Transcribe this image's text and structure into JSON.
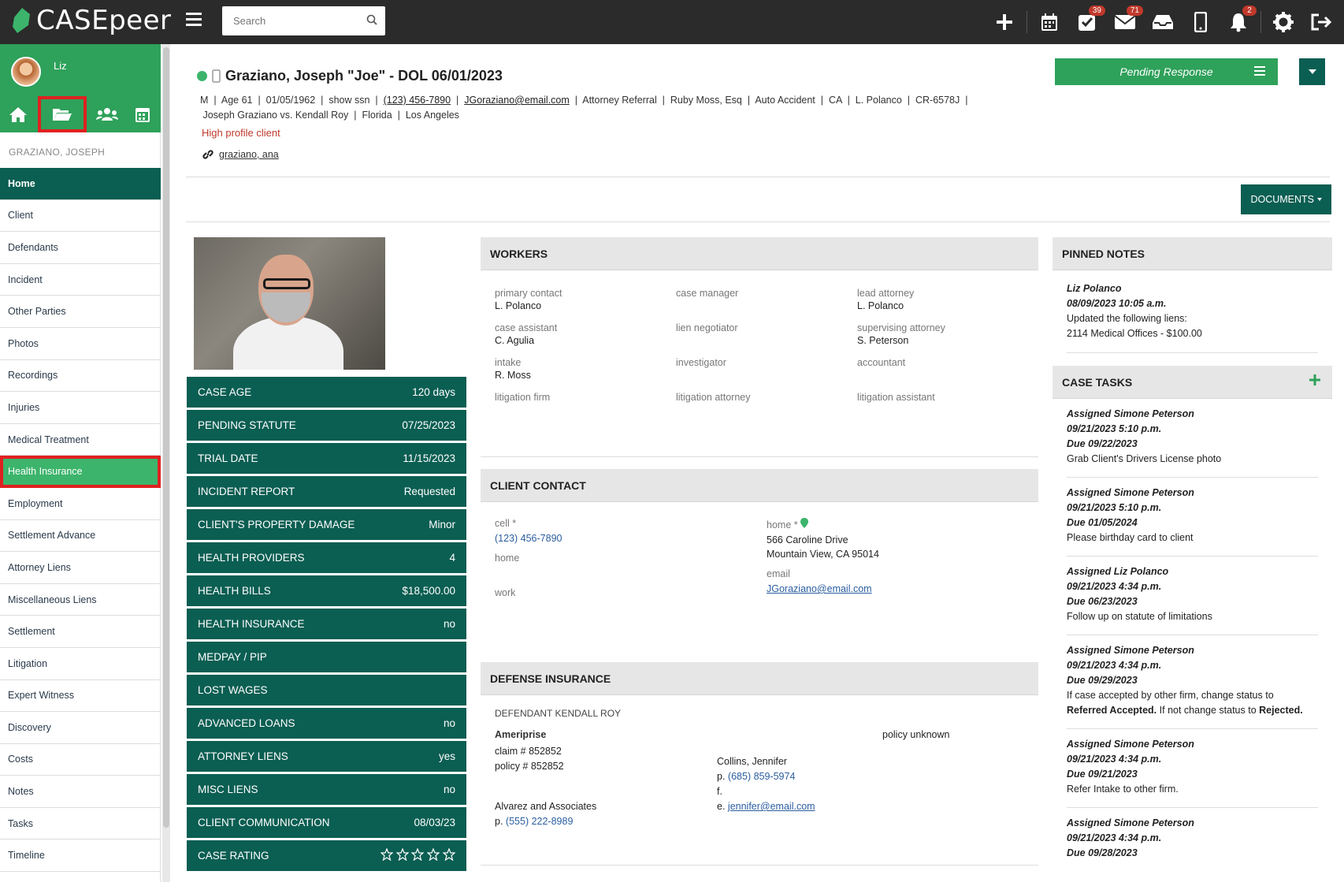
{
  "app": {
    "name": "CASEpeer"
  },
  "search": {
    "placeholder": "Search"
  },
  "topbar": {
    "badges": {
      "tasks": "39",
      "mail": "71",
      "notifications": "2"
    }
  },
  "sidebar": {
    "user_name": "Liz",
    "client_label": "GRAZIANO, JOSEPH",
    "items": [
      {
        "label": "Home"
      },
      {
        "label": "Client"
      },
      {
        "label": "Defendants"
      },
      {
        "label": "Incident"
      },
      {
        "label": "Other Parties"
      },
      {
        "label": "Photos"
      },
      {
        "label": "Recordings"
      },
      {
        "label": "Injuries"
      },
      {
        "label": "Medical Treatment"
      },
      {
        "label": "Health Insurance"
      },
      {
        "label": "Employment"
      },
      {
        "label": "Settlement Advance"
      },
      {
        "label": "Attorney Liens"
      },
      {
        "label": "Miscellaneous Liens"
      },
      {
        "label": "Settlement"
      },
      {
        "label": "Litigation"
      },
      {
        "label": "Expert Witness"
      },
      {
        "label": "Discovery"
      },
      {
        "label": "Costs"
      },
      {
        "label": "Notes"
      },
      {
        "label": "Tasks"
      },
      {
        "label": "Timeline"
      }
    ]
  },
  "case": {
    "title": "Graziano, Joseph \"Joe\" - DOL 06/01/2023",
    "meta_line1": [
      "M",
      "Age 61",
      "01/05/1962",
      "show ssn",
      "(123) 456-7890",
      "JGoraziano@email.com",
      "Attorney Referral",
      "Ruby Moss, Esq",
      "Auto Accident",
      "CA",
      "L. Polanco",
      "CR-6578J"
    ],
    "meta_line2": [
      "Joseph Graziano vs. Kendall Roy",
      "Florida",
      "Los Angeles"
    ],
    "high_profile": "High profile client",
    "related": "graziano, ana",
    "status": "Pending Response",
    "documents": "DOCUMENTS"
  },
  "stats": [
    {
      "label": "CASE AGE",
      "value": "120 days"
    },
    {
      "label": "PENDING STATUTE",
      "value": "07/25/2023"
    },
    {
      "label": "TRIAL DATE",
      "value": "11/15/2023"
    },
    {
      "label": "INCIDENT REPORT",
      "value": "Requested"
    },
    {
      "label": "CLIENT'S PROPERTY DAMAGE",
      "value": "Minor"
    },
    {
      "label": "HEALTH PROVIDERS",
      "value": "4"
    },
    {
      "label": "HEALTH BILLS",
      "value": "$18,500.00"
    },
    {
      "label": "HEALTH INSURANCE",
      "value": "no"
    },
    {
      "label": "MEDPAY / PIP",
      "value": ""
    },
    {
      "label": "LOST WAGES",
      "value": ""
    },
    {
      "label": "ADVANCED LOANS",
      "value": "no"
    },
    {
      "label": "ATTORNEY LIENS",
      "value": "yes"
    },
    {
      "label": "MISC LIENS",
      "value": "no"
    },
    {
      "label": "CLIENT COMMUNICATION",
      "value": "08/03/23"
    },
    {
      "label": "CASE RATING",
      "value": ""
    }
  ],
  "case_rating": 0,
  "workers": {
    "title": "WORKERS",
    "cells": [
      {
        "label": "primary contact",
        "value": "L. Polanco"
      },
      {
        "label": "case manager",
        "value": ""
      },
      {
        "label": "lead attorney",
        "value": "L. Polanco"
      },
      {
        "label": "case assistant",
        "value": "C. Agulia"
      },
      {
        "label": "lien negotiator",
        "value": ""
      },
      {
        "label": "supervising attorney",
        "value": "S. Peterson"
      },
      {
        "label": "intake",
        "value": "R. Moss"
      },
      {
        "label": "investigator",
        "value": ""
      },
      {
        "label": "accountant",
        "value": ""
      },
      {
        "label": "litigation firm",
        "value": ""
      },
      {
        "label": "litigation attorney",
        "value": ""
      },
      {
        "label": "litigation assistant",
        "value": ""
      }
    ]
  },
  "contact": {
    "title": "CLIENT CONTACT",
    "cell_label": "cell *",
    "cell_value": "(123) 456-7890",
    "home_label": "home",
    "work_label": "work",
    "home2_label": "home *",
    "address1": "566 Caroline Drive",
    "address2": "Mountain View, CA 95014",
    "email_label": "email",
    "email": "JGoraziano@email.com"
  },
  "defense": {
    "title": "DEFENSE INSURANCE",
    "defendant": "DEFENDANT KENDALL ROY",
    "carrier": "Ameriprise",
    "claim": "claim # 852852",
    "policy": "policy # 852852",
    "policy_status": "policy unknown",
    "adjuster": "Collins, Jennifer",
    "adj_phone_prefix": "p.",
    "adj_phone": "(685) 859-5974",
    "adj_fax": "f.",
    "adj_email_prefix": "e.",
    "adj_email": "jennifer@email.com",
    "firm": "Alvarez and Associates",
    "firm_phone_prefix": "p.",
    "firm_phone": "(555) 222-8989"
  },
  "pinned": {
    "title": "PINNED NOTES",
    "author": "Liz Polanco",
    "date": "08/09/2023 10:05 a.m.",
    "line1": "Updated the following liens:",
    "line2": "2114 Medical Offices - $100.00"
  },
  "tasks": {
    "title": "CASE TASKS",
    "items": [
      {
        "assigned": "Assigned Simone Peterson",
        "date": "09/21/2023 5:10 p.m.",
        "due": "Due 09/22/2023",
        "text": "Grab Client's Drivers License photo"
      },
      {
        "assigned": "Assigned Simone Peterson",
        "date": "09/21/2023 5:10 p.m.",
        "due": "Due 01/05/2024",
        "text": "Please birthday card to client"
      },
      {
        "assigned": "Assigned Liz Polanco",
        "date": "09/21/2023 4:34 p.m.",
        "due": "Due 06/23/2023",
        "text": "Follow up on statute of limitations"
      },
      {
        "assigned": "Assigned Simone Peterson",
        "date": "09/21/2023 4:34 p.m.",
        "due": "Due 09/29/2023",
        "text_a": "If case accepted by other firm, change status to",
        "text_b1": "Referred Accepted.",
        "text_b2": " If not change status to ",
        "text_b3": "Rejected."
      },
      {
        "assigned": "Assigned Simone Peterson",
        "date": "09/21/2023 4:34 p.m.",
        "due": "Due 09/21/2023",
        "text": "Refer Intake to other firm."
      },
      {
        "assigned": "Assigned Simone Peterson",
        "date": "09/21/2023 4:34 p.m.",
        "due": "Due 09/28/2023",
        "text": ""
      }
    ]
  },
  "colors": {
    "brand_green": "#2ea15a",
    "dark_teal": "#0b5e52",
    "highlight_red": "#e02020"
  }
}
